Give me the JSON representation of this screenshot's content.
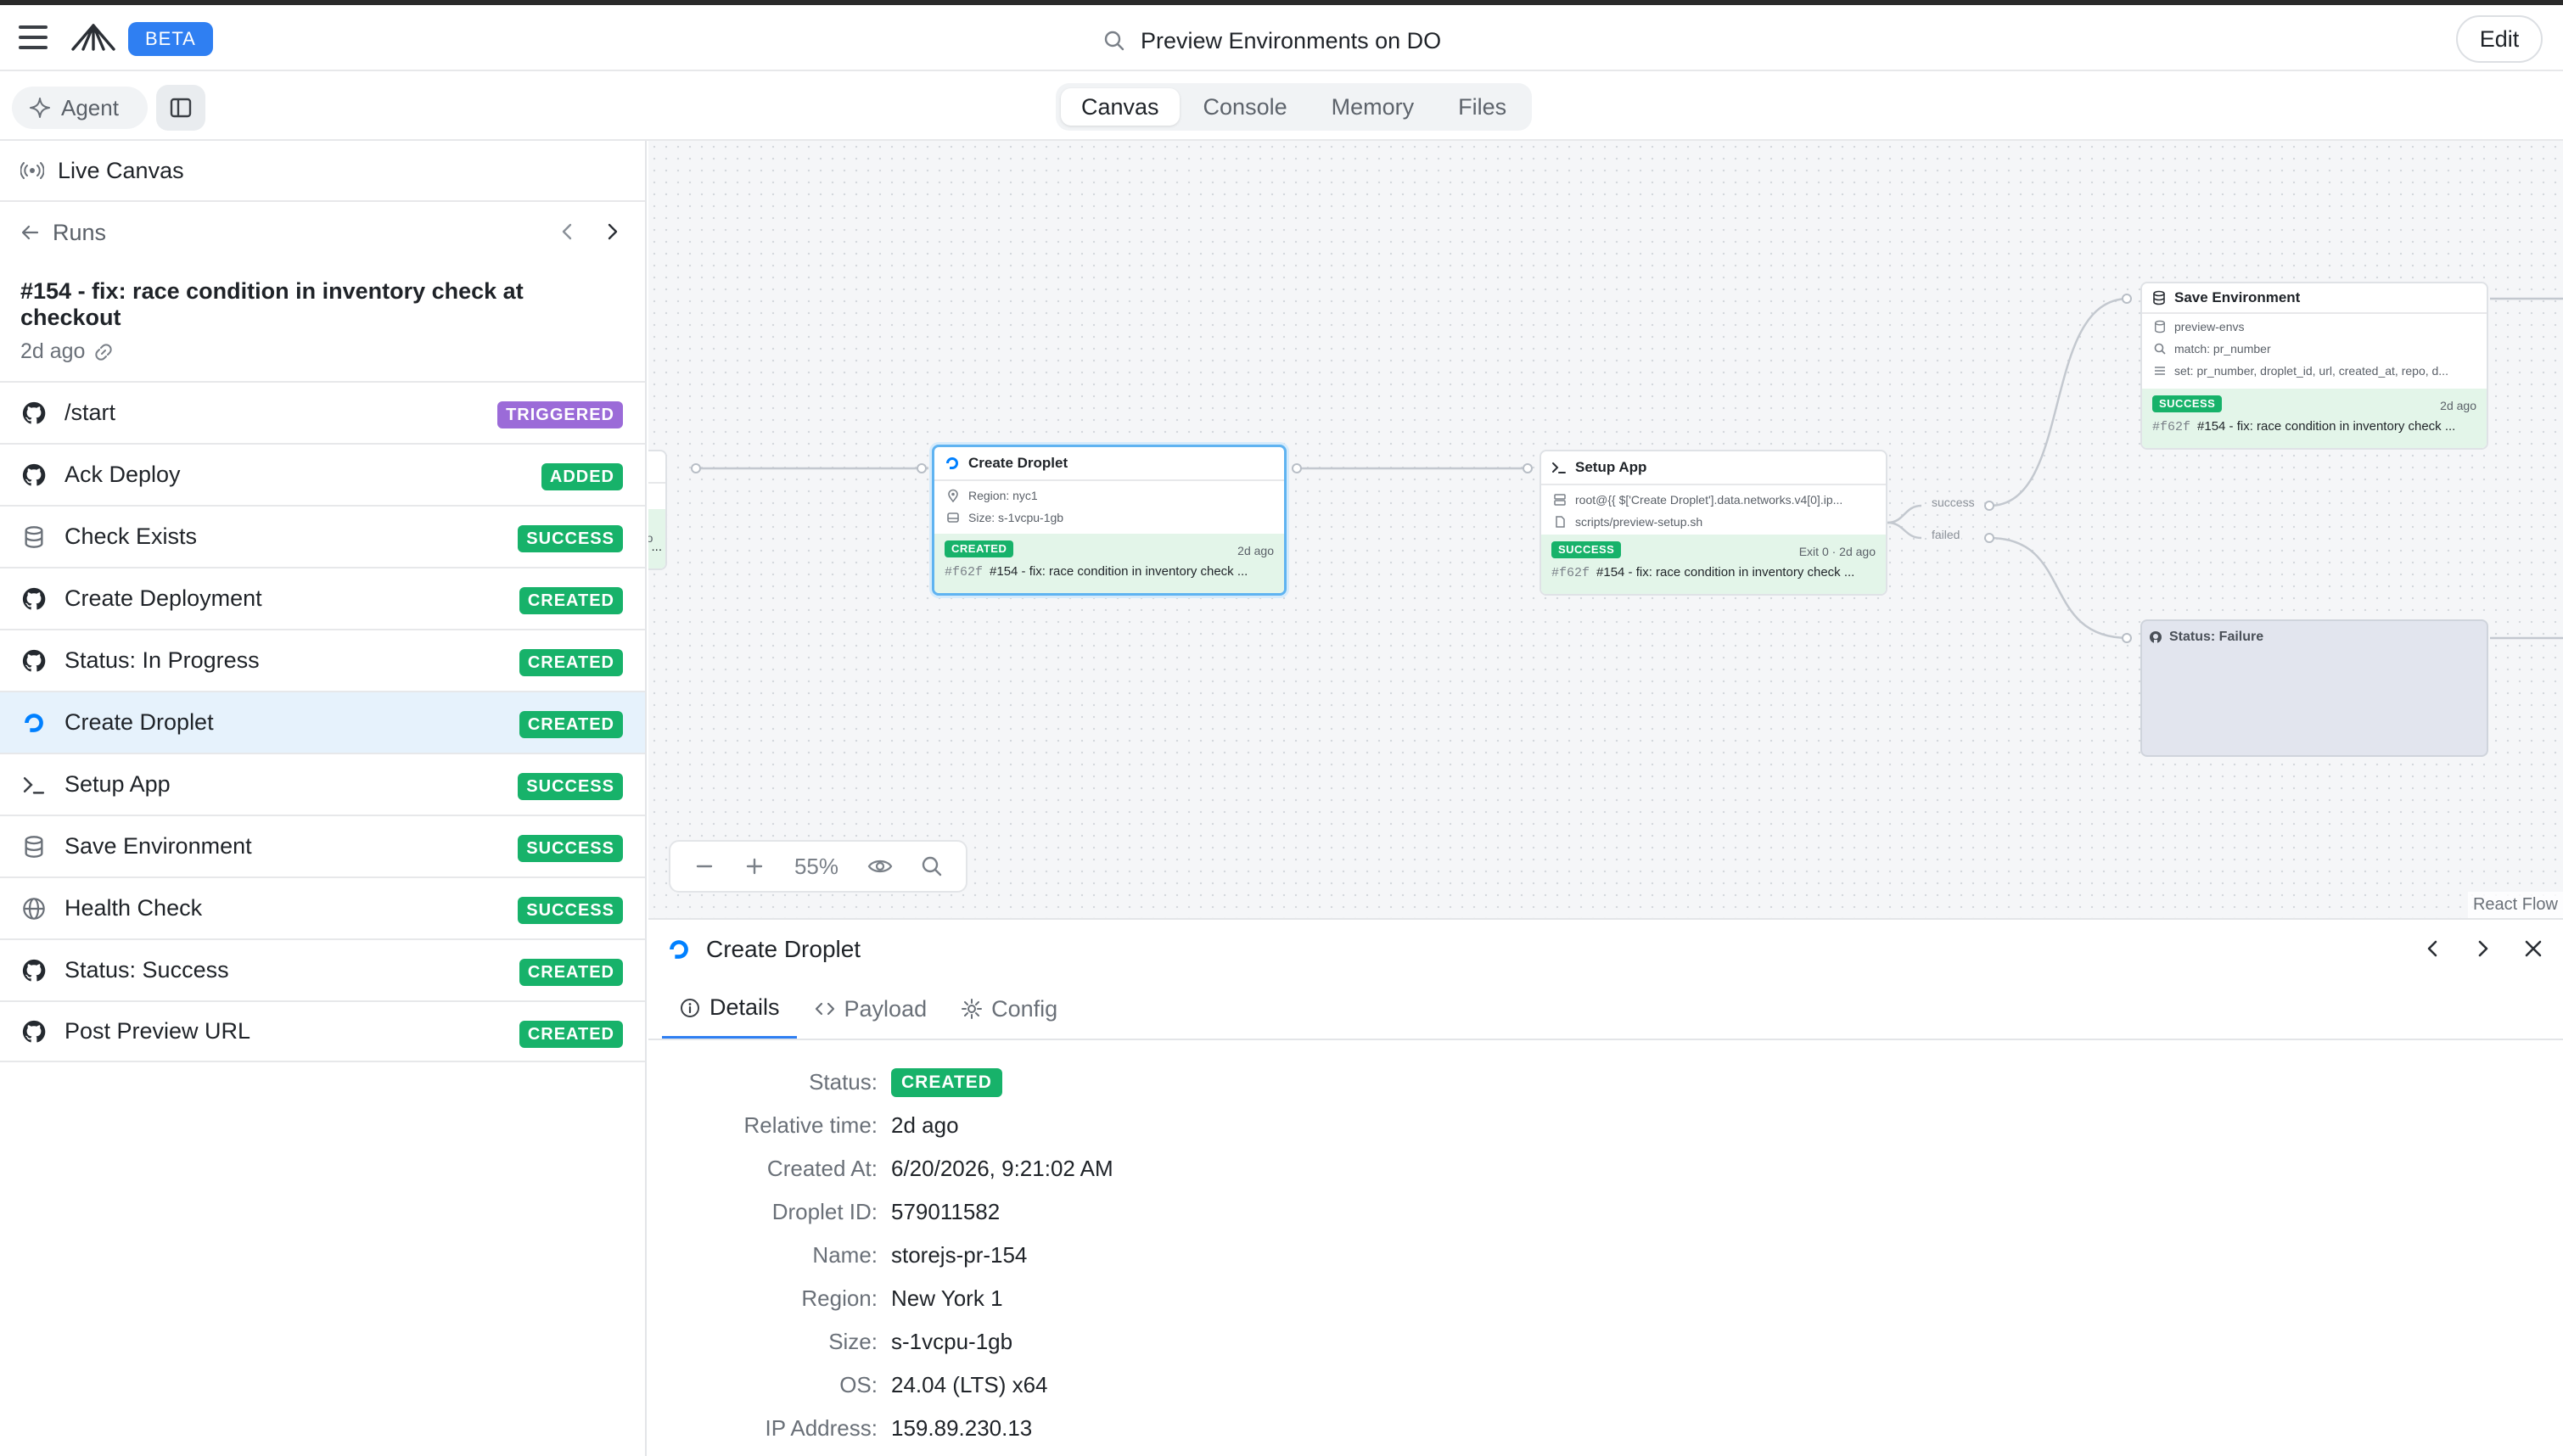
{
  "header": {
    "beta_label": "BETA",
    "title": "Preview Environments on DO",
    "edit_label": "Edit"
  },
  "toolbar": {
    "agent_label": "Agent",
    "tabs": [
      {
        "label": "Canvas",
        "active": true
      },
      {
        "label": "Console",
        "active": false
      },
      {
        "label": "Memory",
        "active": false
      },
      {
        "label": "Files",
        "active": false
      }
    ]
  },
  "sidebar": {
    "live_label": "Live Canvas",
    "runs_label": "Runs",
    "run_title": "#154 - fix: race condition in inventory check at checkout",
    "run_time": "2d ago",
    "steps": [
      {
        "label": "/start",
        "status": "TRIGGERED",
        "icon": "github-icon"
      },
      {
        "label": "Ack Deploy",
        "status": "ADDED",
        "icon": "github-icon"
      },
      {
        "label": "Check Exists",
        "status": "SUCCESS",
        "icon": "database-icon"
      },
      {
        "label": "Create Deployment",
        "status": "CREATED",
        "icon": "github-icon"
      },
      {
        "label": "Status: In Progress",
        "status": "CREATED",
        "icon": "github-icon"
      },
      {
        "label": "Create Droplet",
        "status": "CREATED",
        "icon": "digitalocean-icon",
        "selected": true
      },
      {
        "label": "Setup App",
        "status": "SUCCESS",
        "icon": "terminal-icon"
      },
      {
        "label": "Save Environment",
        "status": "SUCCESS",
        "icon": "database-icon"
      },
      {
        "label": "Health Check",
        "status": "SUCCESS",
        "icon": "globe-icon"
      },
      {
        "label": "Status: Success",
        "status": "CREATED",
        "icon": "github-icon"
      },
      {
        "label": "Post Preview URL",
        "status": "CREATED",
        "icon": "github-icon"
      }
    ]
  },
  "canvas": {
    "partial_node": {
      "time_fragment": "d ago",
      "line_fragment": "ck ..."
    },
    "create_droplet": {
      "title": "Create Droplet",
      "region": "Region: nyc1",
      "size": "Size: s-1vcpu-1gb",
      "status": "CREATED",
      "time": "2d ago",
      "hash": "#f62f",
      "run": "#154 - fix: race condition in inventory check ..."
    },
    "setup_app": {
      "title": "Setup App",
      "host": "root@{{ $['Create Droplet'].data.networks.v4[0].ip...",
      "script": "scripts/preview-setup.sh",
      "status": "SUCCESS",
      "time": "Exit 0 · 2d ago",
      "hash": "#f62f",
      "run": "#154 - fix: race condition in inventory check ..."
    },
    "save_env": {
      "title": "Save Environment",
      "table": "preview-envs",
      "match": "match: pr_number",
      "set": "set: pr_number, droplet_id, url, created_at, repo, d...",
      "status": "SUCCESS",
      "time": "2d ago",
      "hash": "#f62f",
      "run": "#154 - fix: race condition in inventory check ..."
    },
    "status_failure": {
      "title": "Status: Failure"
    },
    "edge_success": "success",
    "edge_failed": "failed",
    "zoom_level": "55%",
    "attribution": "React Flow"
  },
  "detail": {
    "title": "Create Droplet",
    "tabs": [
      "Details",
      "Payload",
      "Config"
    ],
    "fields": [
      {
        "key": "Status:",
        "value": "CREATED",
        "badge": true
      },
      {
        "key": "Relative time:",
        "value": "2d ago"
      },
      {
        "key": "Created At:",
        "value": "6/20/2026, 9:21:02 AM"
      },
      {
        "key": "Droplet ID:",
        "value": "579011582"
      },
      {
        "key": "Name:",
        "value": "storejs-pr-154"
      },
      {
        "key": "Region:",
        "value": "New York 1"
      },
      {
        "key": "Size:",
        "value": "s-1vcpu-1gb"
      },
      {
        "key": "OS:",
        "value": "24.04 (LTS) x64"
      },
      {
        "key": "IP Address:",
        "value": "159.89.230.13"
      }
    ]
  },
  "colors": {
    "accent": "#2f7ff2",
    "success": "#17b26a",
    "triggered": "#9b6bd8",
    "selected_row": "#e6f2fc"
  }
}
